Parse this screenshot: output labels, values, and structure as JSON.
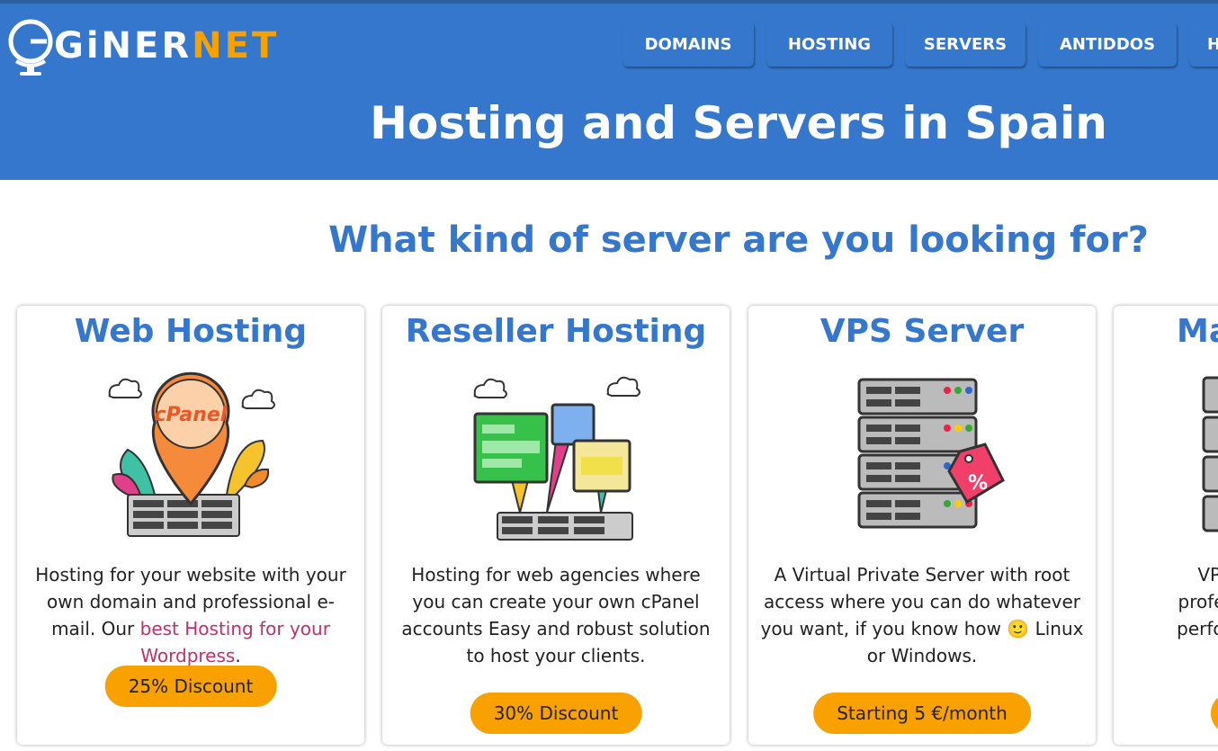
{
  "header": {
    "logo": {
      "prefix": "GiNER",
      "suffix": "NET"
    },
    "nav": [
      {
        "label": "DOMAINS"
      },
      {
        "label": "HOSTING"
      },
      {
        "label": "SERVERS"
      },
      {
        "label": "ANTIDDOS"
      },
      {
        "label": "H"
      }
    ],
    "hero_title": "Hosting and Servers in Spain"
  },
  "section": {
    "title": "What kind of server are you looking for?"
  },
  "cards": [
    {
      "title": "Web Hosting",
      "desc_before": "Hosting for your website with your own domain and professional e-mail. Our ",
      "desc_link": "best Hosting for your Wordpress",
      "desc_after": ".",
      "button": "25% Discount",
      "illustration": "cpanel-icon"
    },
    {
      "title": "Reseller Hosting",
      "desc": "Hosting for web agencies where you can create your own cPanel accounts Easy and robust solution to host your clients.",
      "button": "30% Discount",
      "illustration": "reseller-icon"
    },
    {
      "title": "VPS Server",
      "desc_before": "A Virtual Private Server with root access where you can do whatever you want, if you know how ",
      "emoji": "🙂",
      "desc_after": " Linux or Windows.",
      "button": "Starting 5 €/month",
      "illustration": "server-rack-icon"
    },
    {
      "title": "Ma",
      "desc": "VPS v\nprofessi\nperform",
      "illustration": "server-rack-icon"
    }
  ],
  "colors": {
    "brand_blue": "#3477cc",
    "accent_orange": "#f9a100",
    "link_pink": "#c0306a"
  }
}
